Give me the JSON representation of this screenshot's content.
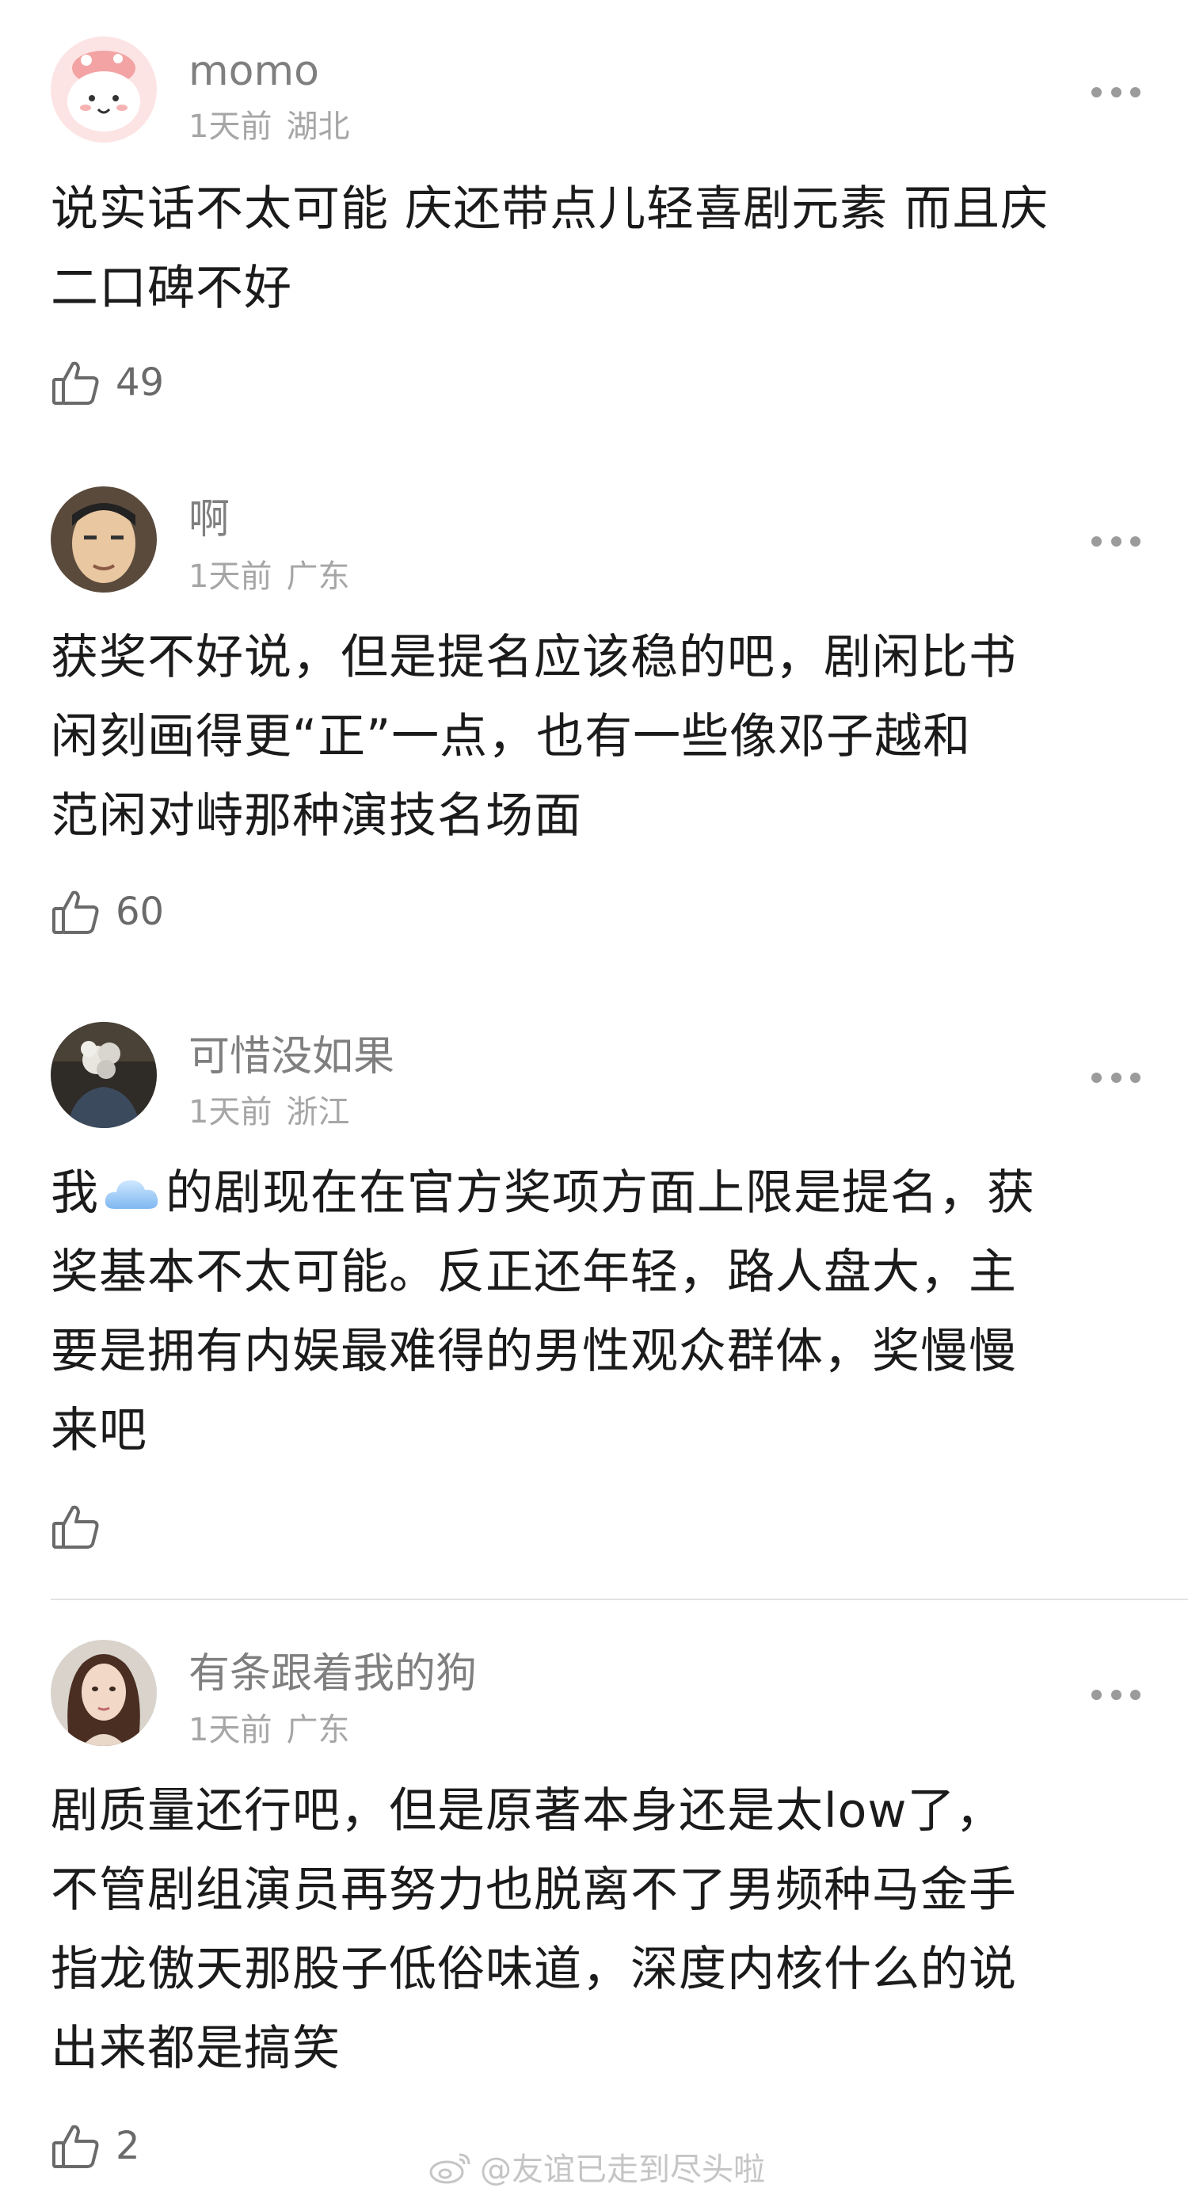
{
  "comments": [
    {
      "username": "momo",
      "time": "1天前",
      "location": "湖北",
      "lines": [
        "说实话不太可能 庆还带点儿轻喜剧元素 而且庆",
        "二口碑不好"
      ],
      "likes": "49"
    },
    {
      "username": "啊",
      "time": "1天前",
      "location": "广东",
      "lines": [
        "获奖不好说，但是提名应该稳的吧，剧闲比书",
        "闲刻画得更“正”一点，也有一些像邓子越和",
        "范闲对峙那种演技名场面"
      ],
      "likes": "60"
    },
    {
      "username": "可惜没如果",
      "time": "1天前",
      "location": "浙江",
      "line1_before_emoji": "我",
      "line1_after_emoji": "的剧现在在官方奖项方面上限是提名，获",
      "lines_rest": [
        "奖基本不太可能。反正还年轻，路人盘大，主",
        "要是拥有内娱最难得的男性观众群体，奖慢慢",
        "来吧"
      ],
      "likes": ""
    },
    {
      "username": "有条跟着我的狗",
      "time": "1天前",
      "location": "广东",
      "lines": [
        "剧质量还行吧，但是原著本身还是太low了，",
        "不管剧组演员再努力也脱离不了男频种马金手",
        "指龙傲天那股子低俗味道，深度内核什么的说",
        "出来都是搞笑"
      ],
      "likes": "2"
    }
  ],
  "watermark": "@友谊已走到尽头啦",
  "icons": [
    "thumbs-up-icon",
    "more-dots-icon",
    "cloud-emoji-icon",
    "weibo-logo-icon"
  ]
}
